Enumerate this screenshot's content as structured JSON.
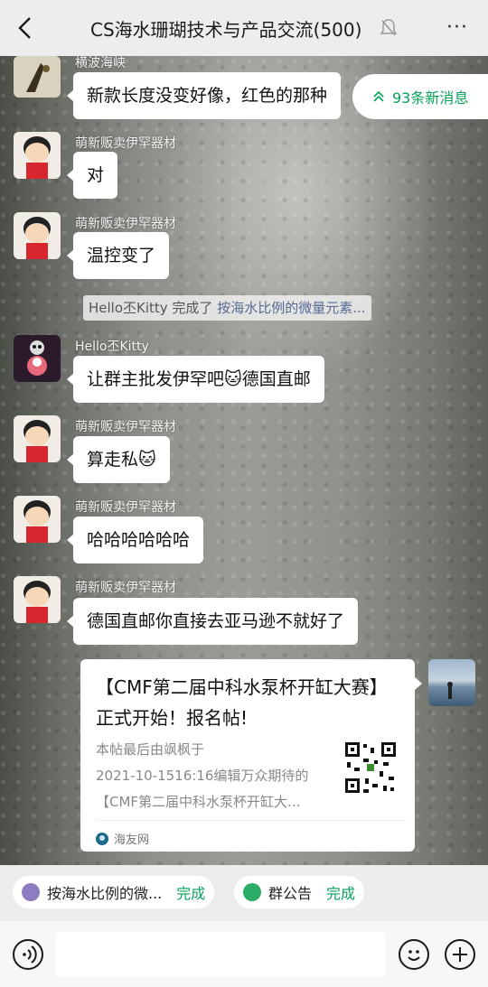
{
  "header": {
    "title": "CS海水珊瑚技术与产品交流(500)",
    "more": "···"
  },
  "new_messages": {
    "label": "93条新消息"
  },
  "messages": [
    {
      "nick": "横波海峡",
      "text": "新款长度没变好像，红色的那种"
    },
    {
      "nick": "萌新贩卖伊罕器材",
      "text": "对"
    },
    {
      "nick": "萌新贩卖伊罕器材",
      "text": "温控变了"
    },
    {
      "nick": "Hello丕Kitty",
      "text": "让群主批发伊罕吧🐱德国直邮"
    },
    {
      "nick": "萌新贩卖伊罕器材",
      "text": "算走私🐱"
    },
    {
      "nick": "萌新贩卖伊罕器材",
      "text": "哈哈哈哈哈哈"
    },
    {
      "nick": "萌新贩卖伊罕器材",
      "text": "德国直邮你直接去亚马逊不就好了"
    }
  ],
  "system_notice": {
    "prefix": "Hello丕Kitty 完成了",
    "link": "按海水比例的微量元素..."
  },
  "card": {
    "title": "【CMF第二届中科水泵杯开缸大赛】正式开始！报名帖!",
    "desc_lines": [
      "本帖最后由飒枫于",
      "2021-10-1516:16编辑万众期待的",
      "【CMF第二届中科水泵杯开缸大..."
    ],
    "source": "海友网"
  },
  "pinned": [
    {
      "label": "按海水比例的微...",
      "status": "完成"
    },
    {
      "label": "群公告",
      "status": "完成"
    }
  ],
  "colors": {
    "accent_green": "#07a35b",
    "link_blue": "#576b95"
  }
}
